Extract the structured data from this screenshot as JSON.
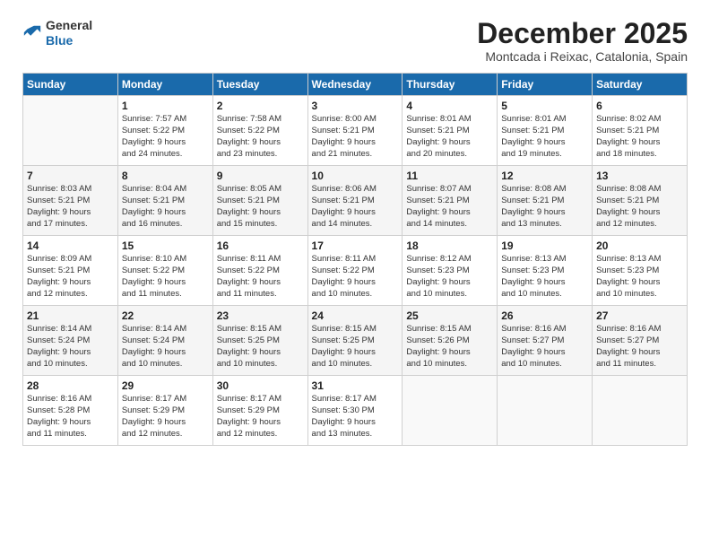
{
  "logo": {
    "general": "General",
    "blue": "Blue"
  },
  "header": {
    "month": "December 2025",
    "location": "Montcada i Reixac, Catalonia, Spain"
  },
  "days_of_week": [
    "Sunday",
    "Monday",
    "Tuesday",
    "Wednesday",
    "Thursday",
    "Friday",
    "Saturday"
  ],
  "weeks": [
    [
      {
        "day": "",
        "info": ""
      },
      {
        "day": "1",
        "info": "Sunrise: 7:57 AM\nSunset: 5:22 PM\nDaylight: 9 hours\nand 24 minutes."
      },
      {
        "day": "2",
        "info": "Sunrise: 7:58 AM\nSunset: 5:22 PM\nDaylight: 9 hours\nand 23 minutes."
      },
      {
        "day": "3",
        "info": "Sunrise: 8:00 AM\nSunset: 5:21 PM\nDaylight: 9 hours\nand 21 minutes."
      },
      {
        "day": "4",
        "info": "Sunrise: 8:01 AM\nSunset: 5:21 PM\nDaylight: 9 hours\nand 20 minutes."
      },
      {
        "day": "5",
        "info": "Sunrise: 8:01 AM\nSunset: 5:21 PM\nDaylight: 9 hours\nand 19 minutes."
      },
      {
        "day": "6",
        "info": "Sunrise: 8:02 AM\nSunset: 5:21 PM\nDaylight: 9 hours\nand 18 minutes."
      }
    ],
    [
      {
        "day": "7",
        "info": "Sunrise: 8:03 AM\nSunset: 5:21 PM\nDaylight: 9 hours\nand 17 minutes."
      },
      {
        "day": "8",
        "info": "Sunrise: 8:04 AM\nSunset: 5:21 PM\nDaylight: 9 hours\nand 16 minutes."
      },
      {
        "day": "9",
        "info": "Sunrise: 8:05 AM\nSunset: 5:21 PM\nDaylight: 9 hours\nand 15 minutes."
      },
      {
        "day": "10",
        "info": "Sunrise: 8:06 AM\nSunset: 5:21 PM\nDaylight: 9 hours\nand 14 minutes."
      },
      {
        "day": "11",
        "info": "Sunrise: 8:07 AM\nSunset: 5:21 PM\nDaylight: 9 hours\nand 14 minutes."
      },
      {
        "day": "12",
        "info": "Sunrise: 8:08 AM\nSunset: 5:21 PM\nDaylight: 9 hours\nand 13 minutes."
      },
      {
        "day": "13",
        "info": "Sunrise: 8:08 AM\nSunset: 5:21 PM\nDaylight: 9 hours\nand 12 minutes."
      }
    ],
    [
      {
        "day": "14",
        "info": "Sunrise: 8:09 AM\nSunset: 5:21 PM\nDaylight: 9 hours\nand 12 minutes."
      },
      {
        "day": "15",
        "info": "Sunrise: 8:10 AM\nSunset: 5:22 PM\nDaylight: 9 hours\nand 11 minutes."
      },
      {
        "day": "16",
        "info": "Sunrise: 8:11 AM\nSunset: 5:22 PM\nDaylight: 9 hours\nand 11 minutes."
      },
      {
        "day": "17",
        "info": "Sunrise: 8:11 AM\nSunset: 5:22 PM\nDaylight: 9 hours\nand 10 minutes."
      },
      {
        "day": "18",
        "info": "Sunrise: 8:12 AM\nSunset: 5:23 PM\nDaylight: 9 hours\nand 10 minutes."
      },
      {
        "day": "19",
        "info": "Sunrise: 8:13 AM\nSunset: 5:23 PM\nDaylight: 9 hours\nand 10 minutes."
      },
      {
        "day": "20",
        "info": "Sunrise: 8:13 AM\nSunset: 5:23 PM\nDaylight: 9 hours\nand 10 minutes."
      }
    ],
    [
      {
        "day": "21",
        "info": "Sunrise: 8:14 AM\nSunset: 5:24 PM\nDaylight: 9 hours\nand 10 minutes."
      },
      {
        "day": "22",
        "info": "Sunrise: 8:14 AM\nSunset: 5:24 PM\nDaylight: 9 hours\nand 10 minutes."
      },
      {
        "day": "23",
        "info": "Sunrise: 8:15 AM\nSunset: 5:25 PM\nDaylight: 9 hours\nand 10 minutes."
      },
      {
        "day": "24",
        "info": "Sunrise: 8:15 AM\nSunset: 5:25 PM\nDaylight: 9 hours\nand 10 minutes."
      },
      {
        "day": "25",
        "info": "Sunrise: 8:15 AM\nSunset: 5:26 PM\nDaylight: 9 hours\nand 10 minutes."
      },
      {
        "day": "26",
        "info": "Sunrise: 8:16 AM\nSunset: 5:27 PM\nDaylight: 9 hours\nand 10 minutes."
      },
      {
        "day": "27",
        "info": "Sunrise: 8:16 AM\nSunset: 5:27 PM\nDaylight: 9 hours\nand 11 minutes."
      }
    ],
    [
      {
        "day": "28",
        "info": "Sunrise: 8:16 AM\nSunset: 5:28 PM\nDaylight: 9 hours\nand 11 minutes."
      },
      {
        "day": "29",
        "info": "Sunrise: 8:17 AM\nSunset: 5:29 PM\nDaylight: 9 hours\nand 12 minutes."
      },
      {
        "day": "30",
        "info": "Sunrise: 8:17 AM\nSunset: 5:29 PM\nDaylight: 9 hours\nand 12 minutes."
      },
      {
        "day": "31",
        "info": "Sunrise: 8:17 AM\nSunset: 5:30 PM\nDaylight: 9 hours\nand 13 minutes."
      },
      {
        "day": "",
        "info": ""
      },
      {
        "day": "",
        "info": ""
      },
      {
        "day": "",
        "info": ""
      }
    ]
  ]
}
